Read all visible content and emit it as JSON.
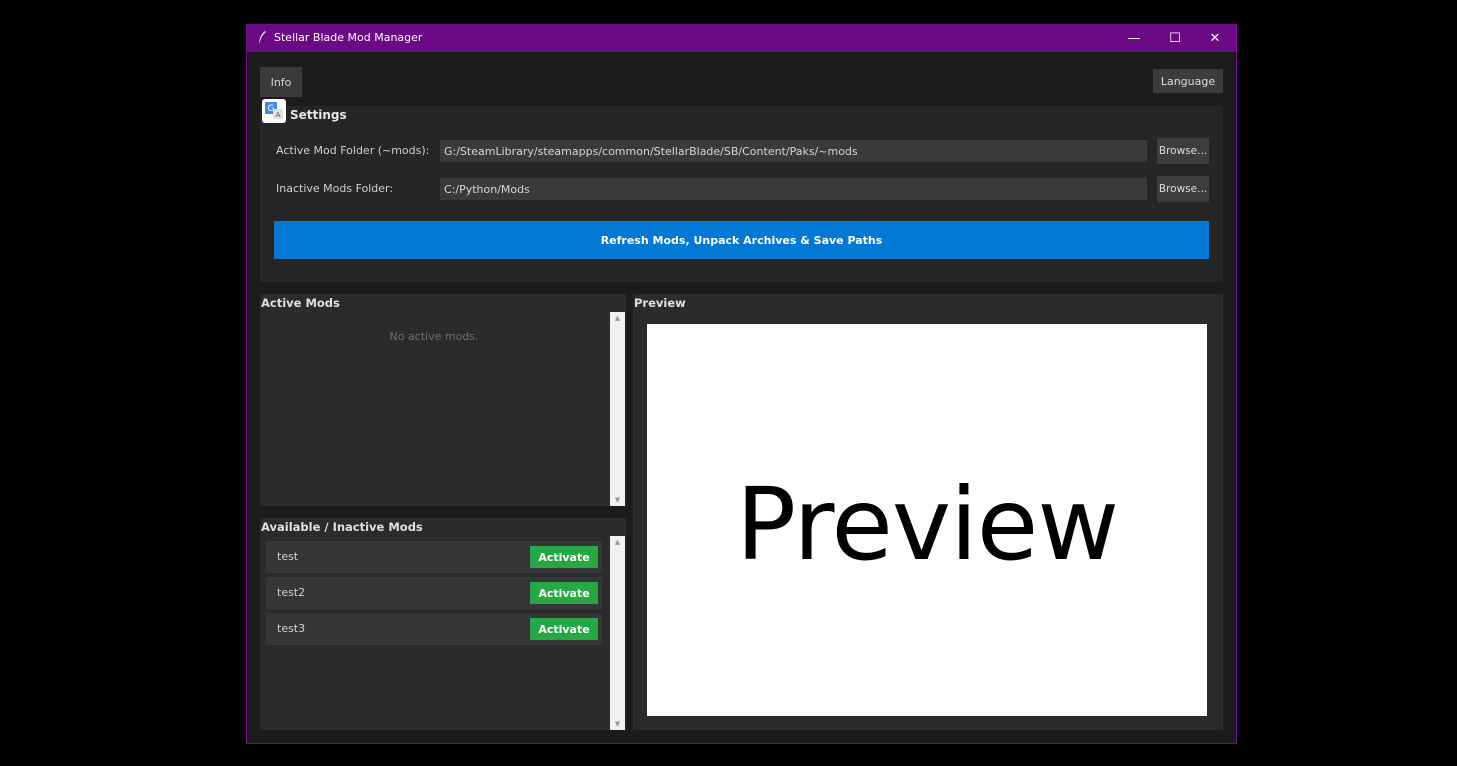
{
  "window": {
    "title": "Stellar Blade Mod Manager",
    "controls": {
      "minimize": "—",
      "maximize": "☐",
      "close": "✕"
    },
    "accent": "#6c0a86"
  },
  "toolbar": {
    "info_label": "Info",
    "language_label": "Language"
  },
  "settings": {
    "title": "Settings",
    "active_folder_label": "Active Mod Folder (~mods):",
    "active_folder_value": "G:/SteamLibrary/steamapps/common/StellarBlade/SB/Content/Paks/~mods",
    "inactive_folder_label": "Inactive Mods Folder:",
    "inactive_folder_value": "C:/Python/Mods",
    "browse_label": "Browse...",
    "refresh_label": "Refresh Mods, Unpack Archives & Save Paths",
    "refresh_color": "#0078d4"
  },
  "active_mods": {
    "title": "Active Mods",
    "empty_message": "No active mods."
  },
  "inactive_mods": {
    "title": "Available / Inactive Mods",
    "activate_label": "Activate",
    "activate_color": "#27a844",
    "items": [
      {
        "name": "test"
      },
      {
        "name": "test2"
      },
      {
        "name": "test3"
      }
    ]
  },
  "preview": {
    "title": "Preview",
    "placeholder_text": "Preview"
  }
}
